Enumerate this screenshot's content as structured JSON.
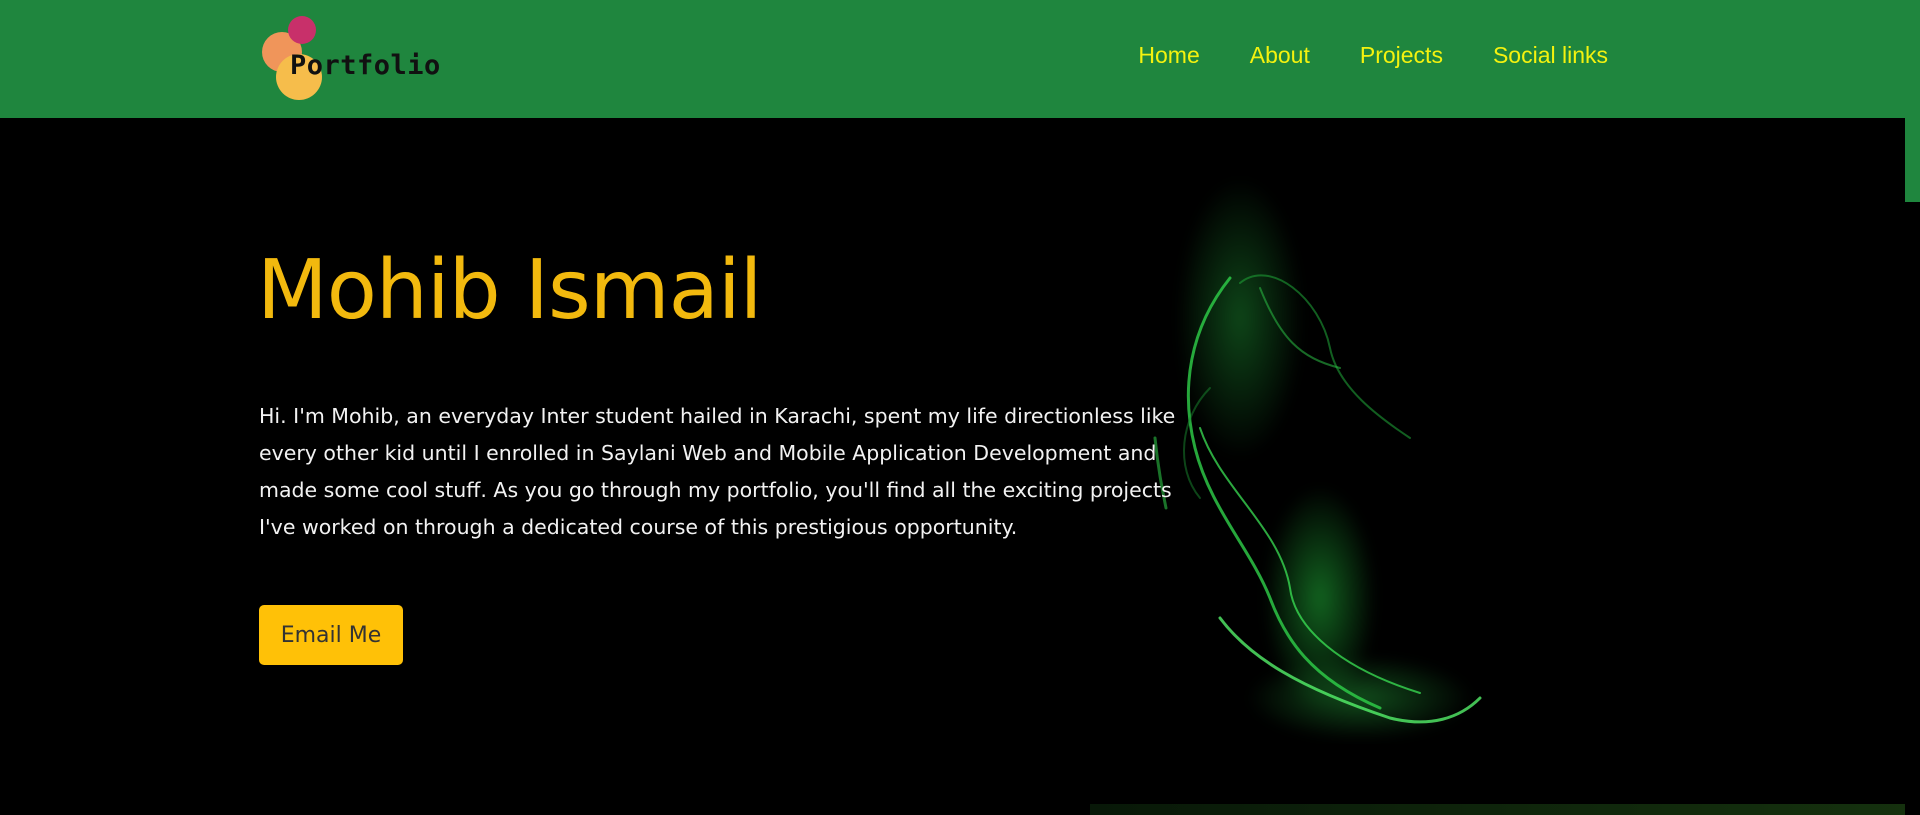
{
  "brand": {
    "logo_text": "Portfolio"
  },
  "nav": {
    "items": [
      {
        "label": "Home"
      },
      {
        "label": "About"
      },
      {
        "label": "Projects"
      },
      {
        "label": "Social links"
      }
    ]
  },
  "hero": {
    "title": "Mohib Ismail",
    "intro": "Hi. I'm Mohib, an everyday Inter student hailed in Karachi, spent my life directionless like every other kid until I enrolled in Saylani Web and Mobile Application Development and made some cool stuff. As you go through my portfolio, you'll find all the exciting projects I've worked on through a dedicated course of this prestigious opportunity.",
    "cta_label": "Email Me"
  },
  "colors": {
    "navbar_bg": "#1f863e",
    "nav_link": "#f4f20f",
    "title": "#f2b90e",
    "button_bg": "#ffc107",
    "hero_bg": "#000000"
  }
}
